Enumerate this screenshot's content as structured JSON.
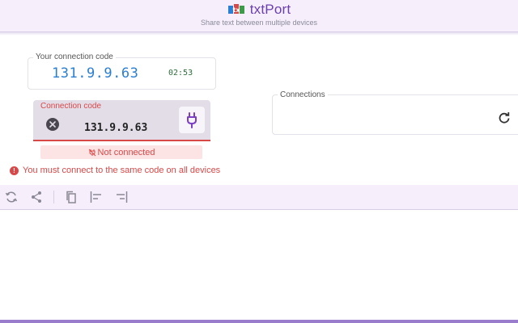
{
  "header": {
    "title": "txtPort",
    "subtitle": "Share text between multiple devices"
  },
  "your_code": {
    "label": "Your connection code",
    "value": "131.9.9.63",
    "timer": "02:53"
  },
  "connection_input": {
    "label": "Connection code",
    "value": "131.9.9.63"
  },
  "status": {
    "text": "Not connected"
  },
  "warning": {
    "text": "You must connect to the same code on all devices"
  },
  "connections": {
    "label": "Connections"
  },
  "toolbar": {
    "tools": [
      "sync-icon",
      "share-icon",
      "copy-icon",
      "align-left-icon",
      "align-right-icon"
    ]
  },
  "colors": {
    "accent": "#6a3fb0",
    "error": "#d94848",
    "code": "#2a7fd3",
    "timer": "#2e6d3e"
  }
}
